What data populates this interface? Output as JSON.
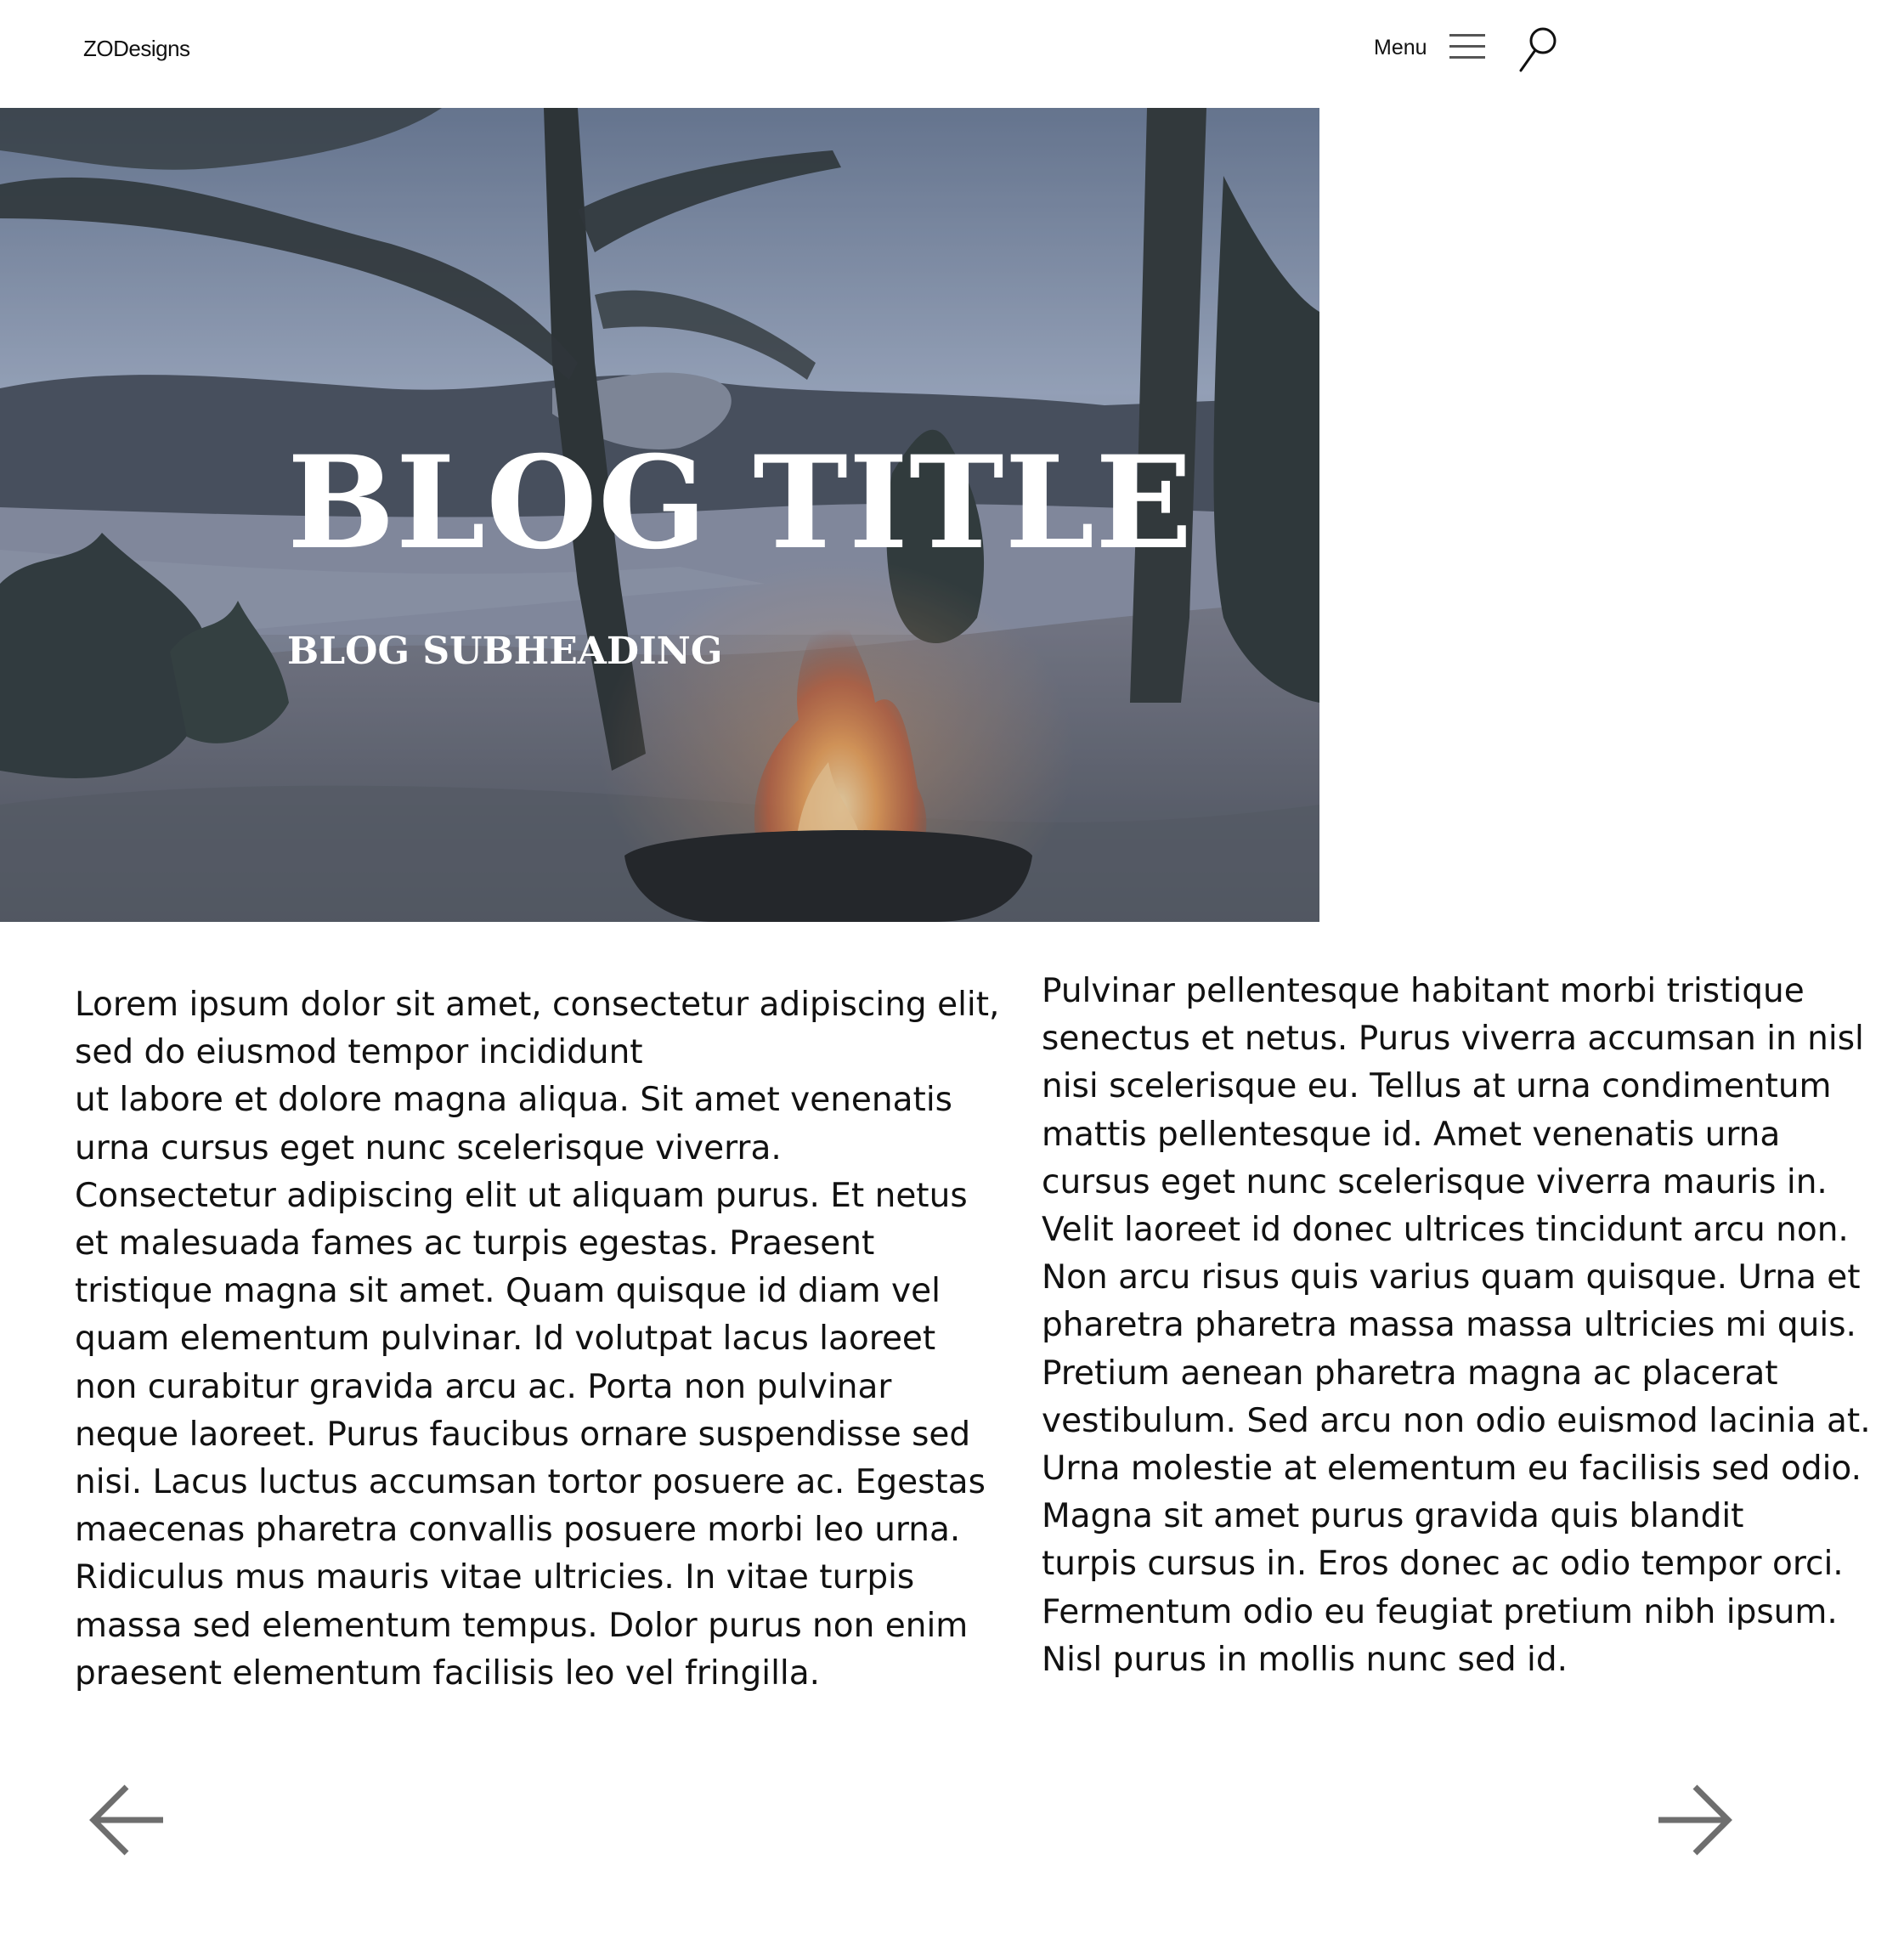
{
  "header": {
    "brand": "ZODesigns",
    "menu_label": "Menu",
    "menu_icon": "hamburger-menu-icon",
    "search_icon": "search-icon"
  },
  "hero": {
    "image": "campfire-in-snowy-forest-by-lake-photo",
    "title": "BLOG TITLE",
    "subtitle": "BLOG SUBHEADING"
  },
  "content": {
    "left_text": "Lorem ipsum dolor sit amet, consectetur adipiscing elit,\nsed do eiusmod tempor incididunt\nut labore et dolore magna aliqua. Sit amet venenatis\nurna cursus eget nunc scelerisque viverra.\nConsectetur adipiscing elit ut aliquam purus. Et netus\net malesuada fames ac turpis egestas. Praesent\ntristique magna sit amet. Quam quisque id diam vel\nquam elementum pulvinar. Id volutpat lacus laoreet\nnon curabitur gravida arcu ac. Porta non pulvinar\nneque laoreet. Purus faucibus ornare suspendisse sed\nnisi. Lacus luctus accumsan tortor posuere ac. Egestas\nmaecenas pharetra convallis posuere morbi leo urna.\nRidiculus mus mauris vitae ultricies. In vitae turpis\nmassa sed elementum tempus. Dolor purus non enim\npraesent elementum facilisis leo vel fringilla.",
    "right_text": "Pulvinar pellentesque habitant morbi tristique\nsenectus et netus. Purus viverra accumsan in nisl\nnisi scelerisque eu. Tellus at urna condimentum\nmattis pellentesque id. Amet venenatis urna\ncursus eget nunc scelerisque viverra mauris in.\nVelit laoreet id donec ultrices tincidunt arcu non.\nNon arcu risus quis varius quam quisque. Urna et\npharetra pharetra massa massa ultricies mi quis.\nPretium aenean pharetra magna ac placerat\nvestibulum. Sed arcu non odio euismod lacinia at.\nUrna molestie at elementum eu facilisis sed odio.\nMagna sit amet purus gravida quis blandit\nturpis cursus in. Eros donec ac odio tempor orci.\nFermentum odio eu feugiat pretium nibh ipsum.\nNisl purus in mollis nunc sed id."
  },
  "navigation": {
    "prev_icon": "arrow-left-icon",
    "next_icon": "arrow-right-icon"
  },
  "colors": {
    "text": "#111111",
    "arrow": "#6e6e6e",
    "background": "#ffffff"
  }
}
